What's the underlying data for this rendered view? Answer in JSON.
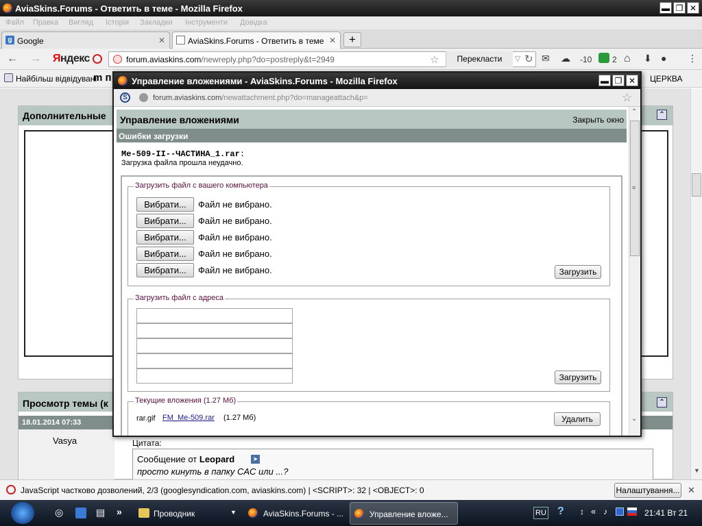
{
  "browser": {
    "window_title": "AviaSkins.Forums - Ответить в теме - Mozilla Firefox",
    "menu": [
      "Файл",
      "Правка",
      "Вигляд",
      "Історія",
      "Закладки",
      "Інструменти",
      "Довідка"
    ],
    "tabs": [
      {
        "label": "Google"
      },
      {
        "label": "AviaSkins.Forums - Ответить в теме"
      }
    ],
    "new_tab": "+",
    "yandex_brand": {
      "first": "Я",
      "rest": "ндекс"
    },
    "url_host": "forum.aviaskins.com",
    "url_path": "/newreply.php?do=postreply&t=2949",
    "translate_label": "Перекласти",
    "weather": "-10",
    "counter": "2",
    "bookmarks": [
      "Найбільш відвідувані",
      "ЦЕРКВА"
    ],
    "bookmark_m": "m п"
  },
  "page": {
    "panel1_title": "Дополнительные",
    "panel2_title": "Просмотр темы (к",
    "post_date": "18.01.2014 07:33",
    "post_author": "Vasya",
    "quote_label": "Цитата:",
    "quote_from": "Сообщение от",
    "quote_author": "Leopard",
    "quote_text": "просто кинуть в папку CAC или ...?"
  },
  "popup": {
    "title": "Управление вложениями - AviaSkins.Forums - Mozilla Firefox",
    "url_host": "forum.aviaskins.com",
    "url_path": "/newattachment.php?do=manageattach&p=",
    "header": "Управление вложениями",
    "close_window": "Закрыть окно",
    "errors_title": "Ошибки загрузки",
    "error_file": "Me-509-II--ЧАСТИНА_1.rar",
    "error_file_suffix": ":",
    "error_message": "Загрузка файла прошла неудачно.",
    "upload_computer_legend": "Загрузить файл с вашего компьютера",
    "file_rows": [
      {
        "button": "Вибрати...",
        "status": "Файл не вибрано."
      },
      {
        "button": "Вибрати...",
        "status": "Файл не вибрано."
      },
      {
        "button": "Вибрати...",
        "status": "Файл не вибрано."
      },
      {
        "button": "Вибрати...",
        "status": "Файл не вибрано."
      },
      {
        "button": "Вибрати...",
        "status": "Файл не вибрано."
      }
    ],
    "upload_button": "Загрузить",
    "upload_url_legend": "Загрузить файл с адреса",
    "url_fields": [
      "",
      "",
      "",
      "",
      ""
    ],
    "upload_button2": "Загрузить",
    "current_legend": "Текущие вложения (1.27 Мб)",
    "attachment_icon": "rar.gif",
    "attachment_link": "FM_Me-509.rar",
    "attachment_size": "(1.27 Мб)",
    "delete_button": "Удалить"
  },
  "statusbar": {
    "text": "JavaScript частково дозволений, 2/3 (googlesyndication.com, aviaskins.com) | <SCRIPT>: 32 | <OBJECT>: 0",
    "settings_button": "Налаштування..."
  },
  "taskbar": {
    "tasks": [
      "Проводник",
      "AviaSkins.Forums - ...",
      "Управление вложе..."
    ],
    "lang": "RU",
    "clock": "21:41 Вт 21"
  },
  "colors": {
    "header_bg": "#b9c7c3",
    "subheader_bg": "#7f8d8b",
    "legend": "#5a0e3e",
    "link": "#1a1a8c"
  }
}
